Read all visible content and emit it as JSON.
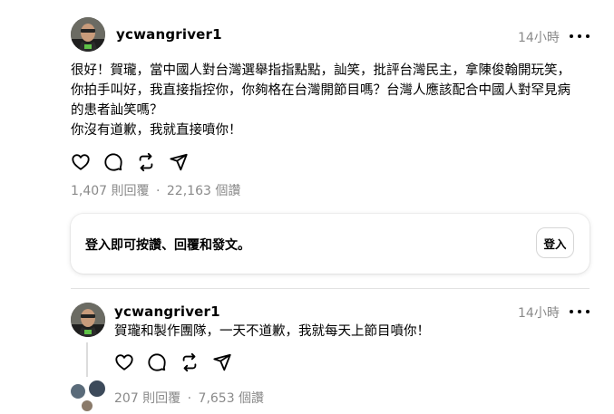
{
  "post": {
    "username": "ycwangriver1",
    "timestamp": "14小時",
    "text": "很好！賀瓏，當中國人對台灣選舉指指點點，訕笑，批評台灣民主，拿陳俊翰開玩笑，\n你拍手叫好，我直接指控你，你夠格在台灣開節目嗎？台灣人應該配合中國人對罕見病\n的患者訕笑嗎？\n你沒有道歉，我就直接噴你！",
    "replies": "1,407 則回覆",
    "separator": "·",
    "views": "22,163 個讚",
    "icons": [
      "heart-icon",
      "comment-icon",
      "repost-icon",
      "share-icon"
    ]
  },
  "login_prompt": {
    "text": "登入即可按讚、回覆和發文。",
    "button": "登入"
  },
  "reply": {
    "username": "ycwangriver1",
    "timestamp": "14小時",
    "text": "賀瓏和製作團隊，一天不道歉，我就每天上節目噴你！",
    "replies": "207 則回覆",
    "separator": "·",
    "views": "7,653 個讚",
    "icons": [
      "heart-icon",
      "comment-icon",
      "repost-icon",
      "share-icon"
    ]
  }
}
